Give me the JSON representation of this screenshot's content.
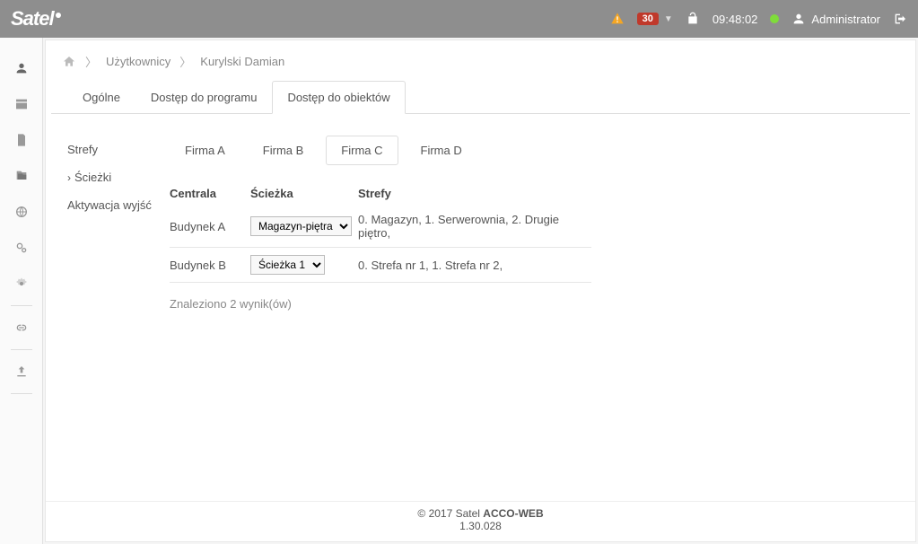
{
  "topbar": {
    "brand": "Satel",
    "alert_count": "30",
    "clock": "09:48:02",
    "user_label": "Administrator"
  },
  "breadcrumb": {
    "item1": "Użytkownicy",
    "item2": "Kurylski Damian"
  },
  "tabs": {
    "t1": "Ogólne",
    "t2": "Dostęp do programu",
    "t3": "Dostęp do obiektów"
  },
  "leftnav": {
    "i1": "Strefy",
    "i2": "Ścieżki",
    "i3": "Aktywacja wyjść"
  },
  "company_tabs": {
    "a": "Firma A",
    "b": "Firma B",
    "c": "Firma C",
    "d": "Firma D"
  },
  "table": {
    "headers": {
      "c1": "Centrala",
      "c2": "Ścieżka",
      "c3": "Strefy"
    },
    "rows": [
      {
        "centrala": "Budynek A",
        "sciezka": "Magazyn-piętra",
        "strefy": "0. Magazyn, 1. Serwerownia, 2. Drugie piętro,"
      },
      {
        "centrala": "Budynek B",
        "sciezka": "Ścieżka 1",
        "strefy": "0. Strefa nr 1, 1. Strefa nr 2,"
      }
    ],
    "results": "Znaleziono 2 wynik(ów)"
  },
  "footer": {
    "copy": "© 2017 Satel ",
    "product": "ACCO-WEB",
    "version": "1.30.028"
  }
}
